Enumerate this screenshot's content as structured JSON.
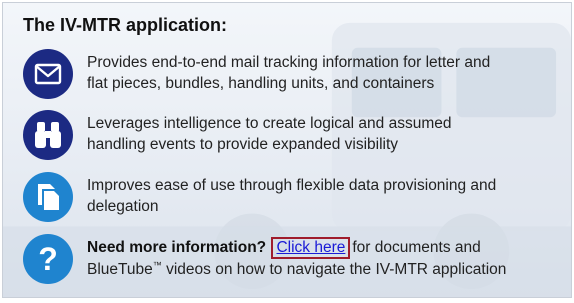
{
  "title": "The IV-MTR application:",
  "items": [
    {
      "icon": "envelope-icon",
      "line1": "Provides end-to-end mail tracking information for letter and",
      "line2": "flat pieces, bundles, handling units, and containers"
    },
    {
      "icon": "binoculars-icon",
      "line1": "Leverages intelligence to create logical and assumed",
      "line2": "handling events to provide expanded visibility"
    },
    {
      "icon": "documents-icon",
      "line1": "Improves ease of use through flexible data provisioning and",
      "line2": "delegation"
    }
  ],
  "help": {
    "icon": "question-mark-icon",
    "bold": "Need more information?",
    "link": "Click here",
    "after_link": "for documents and",
    "line2_start": "BlueTube",
    "trademark": "™",
    "line2_rest": " videos on how to navigate the IV-MTR application"
  },
  "colors": {
    "icon_dark_blue": "#1c2a83",
    "icon_light_blue": "#1f84cf",
    "link": "#1a1ad6",
    "highlight_box": "#a01c2c"
  }
}
